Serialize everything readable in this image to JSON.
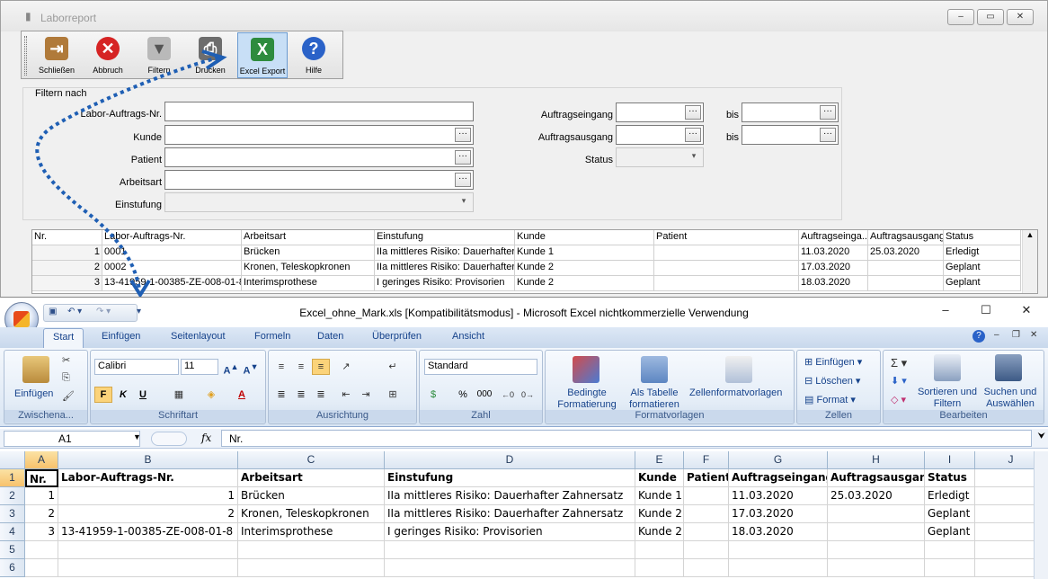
{
  "laborreport": {
    "title": "Laborreport",
    "window_buttons": [
      "–",
      "▭",
      "✕"
    ],
    "toolbar": [
      {
        "label": "Schließen",
        "icon": "door-exit-icon",
        "color": "#9a6a2a"
      },
      {
        "label": "Abbruch",
        "icon": "cancel-icon",
        "color": "#d02020"
      },
      {
        "label": "Filtern",
        "icon": "funnel-icon",
        "color": "#a0a0a0"
      },
      {
        "label": "Drucken",
        "icon": "printer-icon",
        "color": "#606060"
      },
      {
        "label": "Excel Export",
        "icon": "excel-export-icon",
        "color": "#2a8a3a"
      },
      {
        "label": "Hilfe",
        "icon": "help-icon",
        "color": "#2a62c8"
      }
    ],
    "filter": {
      "legend": "Filtern nach",
      "labor_auftrags_nr": "Labor-Auftrags-Nr.",
      "kunde": "Kunde",
      "patient": "Patient",
      "arbeitsart": "Arbeitsart",
      "einstufung": "Einstufung",
      "auftragseingang": "Auftragseingang",
      "auftragsausgang": "Auftragsausgang",
      "status": "Status",
      "bis": "bis",
      "dots": "···"
    },
    "grid": {
      "columns": [
        "Nr.",
        "Labor-Auftrags-Nr.",
        "Arbeitsart",
        "Einstufung",
        "Kunde",
        "Patient",
        "Auftragseinga...",
        "Auftragsausgang",
        "Status"
      ],
      "rows": [
        [
          "1",
          "0001",
          "Brücken",
          "IIa mittleres Risiko: Dauerhafter Z",
          "Kunde 1",
          "",
          "11.03.2020",
          "25.03.2020",
          "Erledigt"
        ],
        [
          "2",
          "0002",
          "Kronen, Teleskopkronen",
          "IIa mittleres Risiko: Dauerhafter Z",
          "Kunde 2",
          "",
          "17.03.2020",
          "",
          "Geplant"
        ],
        [
          "3",
          "13-41959-1-00385-ZE-008-01-8",
          "Interimsprothese",
          "I geringes Risiko: Provisorien",
          "Kunde 2",
          "",
          "18.03.2020",
          "",
          "Geplant"
        ]
      ]
    }
  },
  "excel": {
    "title": "Excel_ohne_Mark.xls  [Kompatibilitätsmodus] - Microsoft Excel nichtkommerzielle Verwendung",
    "window_buttons": [
      "–",
      "☐",
      "✕"
    ],
    "tabs": [
      "Start",
      "Einfügen",
      "Seitenlayout",
      "Formeln",
      "Daten",
      "Überprüfen",
      "Ansicht"
    ],
    "groups": {
      "clipboard": {
        "label": "Zwischena...",
        "paste": "Einfügen"
      },
      "font": {
        "label": "Schriftart",
        "name": "Calibri",
        "size": "11",
        "bold": "F",
        "italic": "K",
        "underline": "U"
      },
      "alignment": {
        "label": "Ausrichtung"
      },
      "number": {
        "label": "Zahl",
        "format": "Standard",
        "percent": "%",
        "thousands": "000"
      },
      "styles": {
        "label": "Formatvorlagen",
        "conditional": "Bedingte Formatierung",
        "as_table": "Als Tabelle formatieren",
        "cell_styles": "Zellenformatvorlagen"
      },
      "cells": {
        "label": "Zellen",
        "insert": "Einfügen",
        "delete": "Löschen",
        "format": "Format"
      },
      "editing": {
        "label": "Bearbeiten",
        "sort": "Sortieren und Filtern",
        "find": "Suchen und Auswählen"
      }
    },
    "namebox": "A1",
    "fx": "fx",
    "formula": "Nr.",
    "columns": [
      "A",
      "B",
      "C",
      "D",
      "E",
      "F",
      "G",
      "H",
      "I",
      "J"
    ],
    "rows": [
      [
        "Nr.",
        "Labor-Auftrags-Nr.",
        "Arbeitsart",
        "Einstufung",
        "Kunde",
        "Patient",
        "Auftragseingang",
        "Auftragsausgang",
        "Status",
        ""
      ],
      [
        "1",
        "1",
        "Brücken",
        "IIa mittleres Risiko: Dauerhafter Zahnersatz",
        "Kunde 1",
        "",
        "11.03.2020",
        "25.03.2020",
        "Erledigt",
        ""
      ],
      [
        "2",
        "2",
        "Kronen, Teleskopkronen",
        "IIa mittleres Risiko: Dauerhafter Zahnersatz",
        "Kunde 2",
        "",
        "17.03.2020",
        "",
        "Geplant",
        ""
      ],
      [
        "3",
        "13-41959-1-00385-ZE-008-01-8",
        "Interimsprothese",
        "I geringes Risiko: Provisorien",
        "Kunde 2",
        "",
        "18.03.2020",
        "",
        "Geplant",
        ""
      ],
      [
        "",
        "",
        "",
        "",
        "",
        "",
        "",
        "",
        "",
        ""
      ],
      [
        "",
        "",
        "",
        "",
        "",
        "",
        "",
        "",
        "",
        ""
      ]
    ],
    "row_numbers": [
      "1",
      "2",
      "3",
      "4",
      "5",
      "6"
    ]
  }
}
